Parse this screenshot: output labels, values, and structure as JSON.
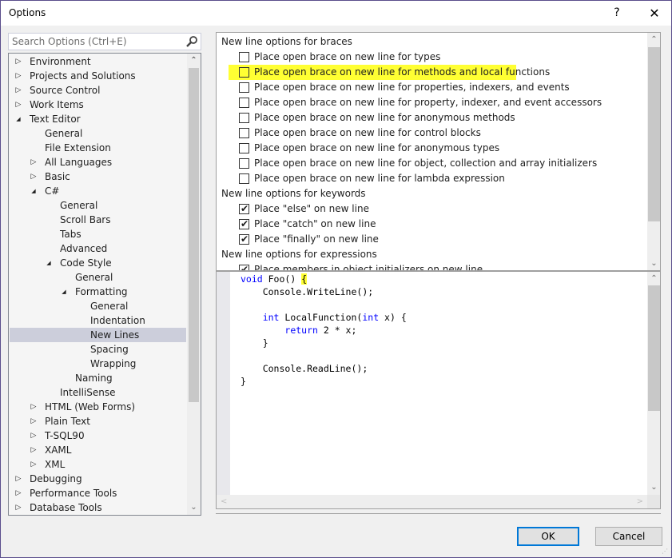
{
  "window": {
    "title": "Options",
    "help_label": "?",
    "close_label": "✕"
  },
  "search": {
    "placeholder": "Search Options (Ctrl+E)",
    "icon": "search-icon"
  },
  "tree": {
    "items": [
      {
        "label": "Environment",
        "level": 0,
        "expander": "collapsed"
      },
      {
        "label": "Projects and Solutions",
        "level": 0,
        "expander": "collapsed"
      },
      {
        "label": "Source Control",
        "level": 0,
        "expander": "collapsed"
      },
      {
        "label": "Work Items",
        "level": 0,
        "expander": "collapsed"
      },
      {
        "label": "Text Editor",
        "level": 0,
        "expander": "expanded"
      },
      {
        "label": "General",
        "level": 1,
        "expander": "none"
      },
      {
        "label": "File Extension",
        "level": 1,
        "expander": "none"
      },
      {
        "label": "All Languages",
        "level": 1,
        "expander": "collapsed"
      },
      {
        "label": "Basic",
        "level": 1,
        "expander": "collapsed"
      },
      {
        "label": "C#",
        "level": 1,
        "expander": "expanded"
      },
      {
        "label": "General",
        "level": 2,
        "expander": "none"
      },
      {
        "label": "Scroll Bars",
        "level": 2,
        "expander": "none"
      },
      {
        "label": "Tabs",
        "level": 2,
        "expander": "none"
      },
      {
        "label": "Advanced",
        "level": 2,
        "expander": "none"
      },
      {
        "label": "Code Style",
        "level": 2,
        "expander": "expanded"
      },
      {
        "label": "General",
        "level": 3,
        "expander": "none"
      },
      {
        "label": "Formatting",
        "level": 3,
        "expander": "expanded"
      },
      {
        "label": "General",
        "level": 4,
        "expander": "none"
      },
      {
        "label": "Indentation",
        "level": 4,
        "expander": "none"
      },
      {
        "label": "New Lines",
        "level": 4,
        "expander": "none",
        "selected": true
      },
      {
        "label": "Spacing",
        "level": 4,
        "expander": "none"
      },
      {
        "label": "Wrapping",
        "level": 4,
        "expander": "none"
      },
      {
        "label": "Naming",
        "level": 3,
        "expander": "none"
      },
      {
        "label": "IntelliSense",
        "level": 2,
        "expander": "none"
      },
      {
        "label": "HTML (Web Forms)",
        "level": 1,
        "expander": "collapsed"
      },
      {
        "label": "Plain Text",
        "level": 1,
        "expander": "collapsed"
      },
      {
        "label": "T-SQL90",
        "level": 1,
        "expander": "collapsed"
      },
      {
        "label": "XAML",
        "level": 1,
        "expander": "collapsed"
      },
      {
        "label": "XML",
        "level": 1,
        "expander": "collapsed"
      },
      {
        "label": "Debugging",
        "level": 0,
        "expander": "collapsed"
      },
      {
        "label": "Performance Tools",
        "level": 0,
        "expander": "collapsed"
      },
      {
        "label": "Database Tools",
        "level": 0,
        "expander": "collapsed"
      }
    ]
  },
  "options": {
    "sections": [
      {
        "header": "New line options for braces",
        "items": [
          {
            "label": "Place open brace on new line for types",
            "checked": false
          },
          {
            "label": "Place open brace on new line for methods and local functions",
            "checked": false,
            "highlighted": true
          },
          {
            "label": "Place open brace on new line for properties, indexers, and events",
            "checked": false
          },
          {
            "label": "Place open brace on new line for property, indexer, and event accessors",
            "checked": false
          },
          {
            "label": "Place open brace on new line for anonymous methods",
            "checked": false
          },
          {
            "label": "Place open brace on new line for control blocks",
            "checked": false
          },
          {
            "label": "Place open brace on new line for anonymous types",
            "checked": false
          },
          {
            "label": "Place open brace on new line for object, collection and array initializers",
            "checked": false
          },
          {
            "label": "Place open brace on new line for lambda expression",
            "checked": false
          }
        ]
      },
      {
        "header": "New line options for keywords",
        "items": [
          {
            "label": "Place \"else\" on new line",
            "checked": true
          },
          {
            "label": "Place \"catch\" on new line",
            "checked": true
          },
          {
            "label": "Place \"finally\" on new line",
            "checked": true
          }
        ]
      },
      {
        "header": "New line options for expressions",
        "items": [
          {
            "label": "Place members in object initializers on new line",
            "checked": true
          }
        ]
      }
    ]
  },
  "preview": {
    "lines": [
      [
        {
          "t": "void",
          "kw": true
        },
        {
          "t": " Foo() "
        },
        {
          "t": "{",
          "hl": true
        }
      ],
      [
        {
          "t": "    Console.WriteLine();"
        }
      ],
      [
        {
          "t": ""
        }
      ],
      [
        {
          "t": "    "
        },
        {
          "t": "int",
          "kw": true
        },
        {
          "t": " LocalFunction("
        },
        {
          "t": "int",
          "kw": true
        },
        {
          "t": " x) {"
        }
      ],
      [
        {
          "t": "        "
        },
        {
          "t": "return",
          "kw": true
        },
        {
          "t": " 2 * x;"
        }
      ],
      [
        {
          "t": "    }"
        }
      ],
      [
        {
          "t": ""
        }
      ],
      [
        {
          "t": "    Console.ReadLine();"
        }
      ],
      [
        {
          "t": "}"
        }
      ]
    ]
  },
  "buttons": {
    "ok": "OK",
    "cancel": "Cancel"
  },
  "colors": {
    "highlight": "#ffff33",
    "selection": "#cccedb",
    "keyword": "#0000ff",
    "focus_border": "#0078d7",
    "window_border": "#5a4e8c"
  }
}
